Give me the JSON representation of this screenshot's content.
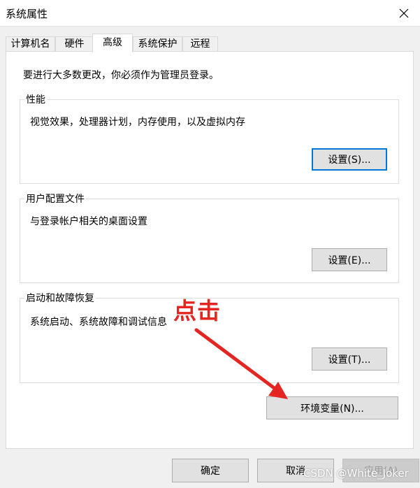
{
  "window": {
    "title": "系统属性",
    "close_icon": "close-icon"
  },
  "tabs": [
    {
      "label": "计算机名"
    },
    {
      "label": "硬件"
    },
    {
      "label": "高级",
      "active": true
    },
    {
      "label": "系统保护"
    },
    {
      "label": "远程"
    }
  ],
  "panel": {
    "admin_note": "要进行大多数更改，你必须作为管理员登录。",
    "performance": {
      "title": "性能",
      "desc": "视觉效果，处理器计划，内存使用，以及虚拟内存",
      "button": "设置(S)..."
    },
    "user_profiles": {
      "title": "用户配置文件",
      "desc": "与登录帐户相关的桌面设置",
      "button": "设置(E)..."
    },
    "startup_recovery": {
      "title": "启动和故障恢复",
      "desc": "系统启动、系统故障和调试信息",
      "button": "设置(T)..."
    },
    "env_vars_button": "环境变量(N)..."
  },
  "footer": {
    "ok": "确定",
    "cancel": "取消",
    "apply": "应用(A)"
  },
  "annotation": {
    "text": "点击",
    "color": "#e52521"
  },
  "watermark": "CSDN @White_Joker",
  "colors": {
    "focus": "#0078d7",
    "annotation_red": "#e52521"
  }
}
